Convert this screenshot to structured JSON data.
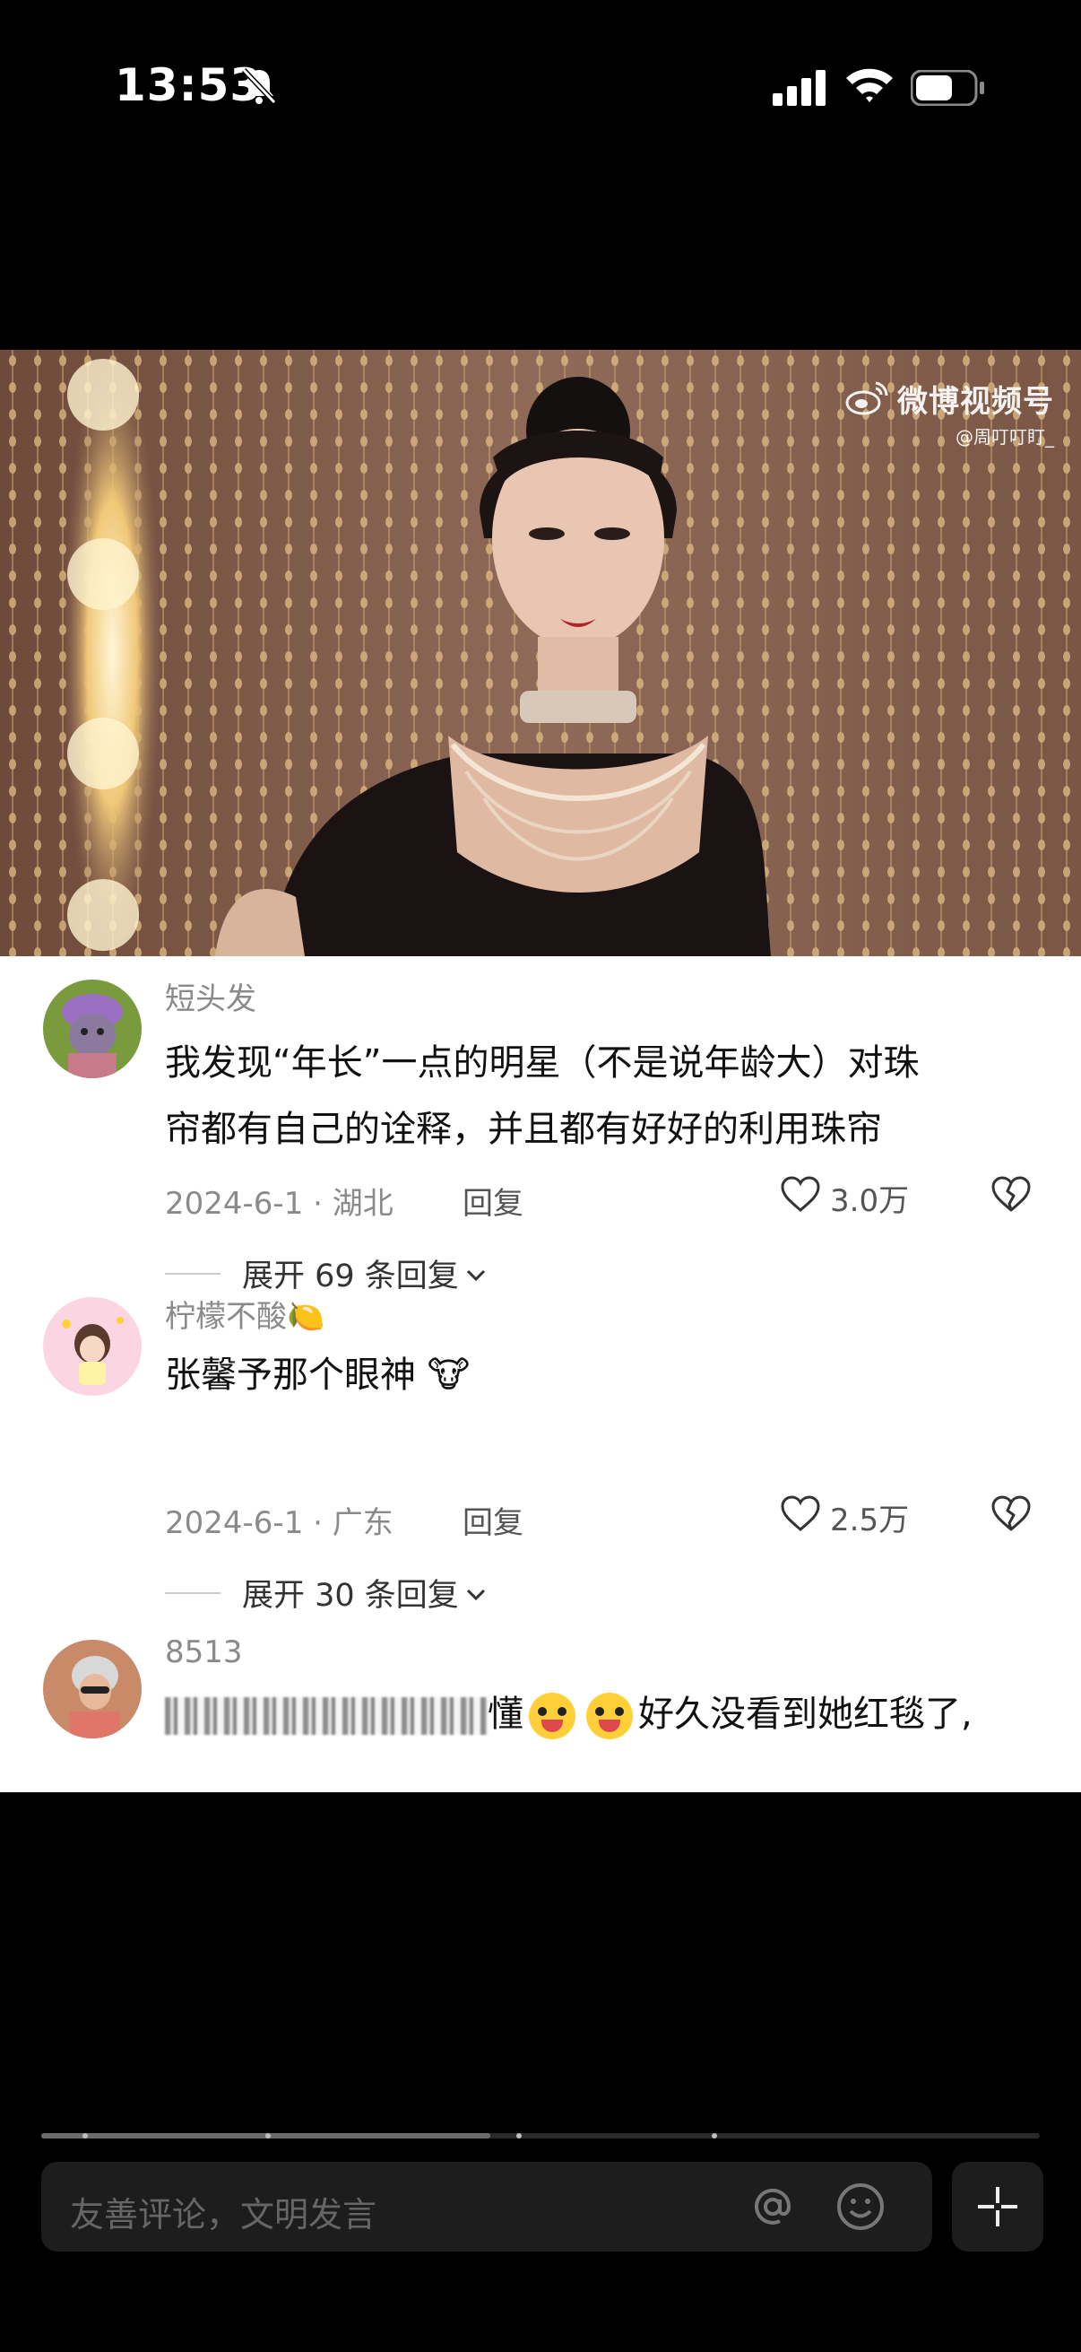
{
  "status_bar": {
    "time": "13:53"
  },
  "video": {
    "watermark_title": "微博视频号",
    "watermark_handle": "@周叮叮盯_"
  },
  "comments": [
    {
      "username": "短头发",
      "text_lines": [
        "我发现“年长”一点的明星（不是说年龄大）对珠",
        "帘都有自己的诠释，并且都有好好的利用珠帘"
      ],
      "date_location": "2024-6-1 · 湖北",
      "reply_label": "回复",
      "likes": "3.0万",
      "expand_label": "展开 69 条回复"
    },
    {
      "username": "柠檬不酸",
      "username_emoji": "🍋",
      "text": "张馨予那个眼神",
      "text_emoji": "🐮",
      "date_location": "2024-6-1 · 广东",
      "reply_label": "回复",
      "likes": "2.5万",
      "expand_label": "展开 30 条回复"
    },
    {
      "username": "8513",
      "text_visible_a": "懂",
      "text_visible_b": "好久没看到她红毯了,"
    }
  ],
  "progress": {
    "fraction": 0.45
  },
  "input": {
    "placeholder": "友善评论，文明发言"
  },
  "icons": {
    "bell": "bell-slash-icon",
    "signal": "cellular-signal-icon",
    "wifi": "wifi-icon",
    "battery": "battery-icon",
    "at": "at-icon",
    "smile": "smile-icon",
    "plus": "plus-icon",
    "heart": "heart-icon",
    "broken_heart": "broken-heart-icon",
    "chevron": "chevron-down-icon",
    "weibo": "weibo-logo-icon"
  },
  "colors": {
    "background": "#000000",
    "panel": "#ffffff",
    "muted_text": "#8a8a8a",
    "input_bg": "#1d1d1d"
  }
}
